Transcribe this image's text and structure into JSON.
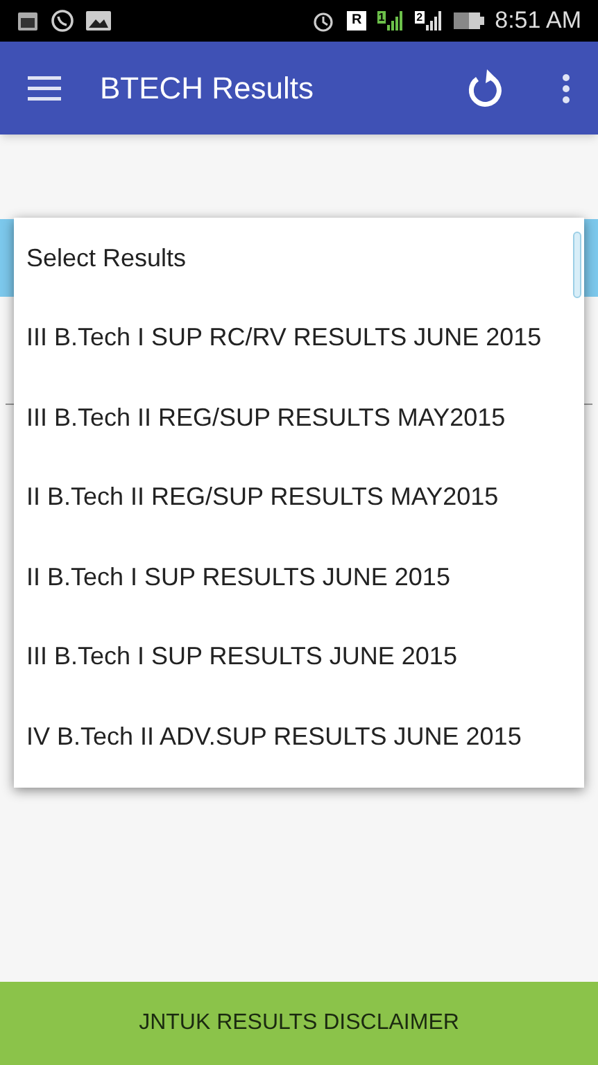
{
  "status_bar": {
    "roaming": "R",
    "sim_1": "1",
    "sim_2": "2",
    "time": "8:51 AM"
  },
  "app_bar": {
    "title": "BTECH Results"
  },
  "dropdown": {
    "header": "Select Results",
    "items": [
      "III B.Tech I SUP RC/RV RESULTS JUNE 2015",
      "III B.Tech II REG/SUP RESULTS MAY2015",
      "II B.Tech II REG/SUP RESULTS MAY2015",
      "II B.Tech I SUP RESULTS JUNE 2015",
      "III B.Tech I SUP RESULTS JUNE 2015",
      "IV B.Tech II ADV.SUP RESULTS JUNE 2015"
    ]
  },
  "footer": {
    "button": "JNTUK RESULTS DISCLAIMER"
  }
}
